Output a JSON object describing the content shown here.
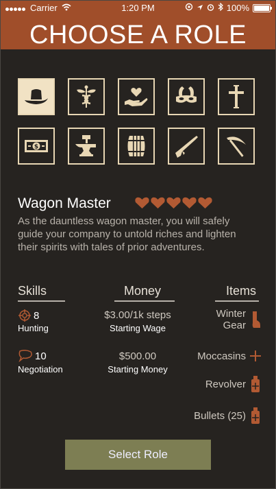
{
  "status_bar": {
    "carrier": "Carrier",
    "time": "1:20 PM",
    "battery": "100%"
  },
  "header": {
    "title": "CHOOSE A ROLE"
  },
  "roles": [
    {
      "icon": "cowboy-hat-icon",
      "selected": true
    },
    {
      "icon": "caduceus-icon",
      "selected": false
    },
    {
      "icon": "heart-in-hand-icon",
      "selected": false
    },
    {
      "icon": "horseshoe-mask-icon",
      "selected": false
    },
    {
      "icon": "cross-icon",
      "selected": false
    },
    {
      "icon": "money-bill-icon",
      "selected": false
    },
    {
      "icon": "anvil-hammer-icon",
      "selected": false
    },
    {
      "icon": "barrel-icon",
      "selected": false
    },
    {
      "icon": "rifle-icon",
      "selected": false
    },
    {
      "icon": "pickaxe-icon",
      "selected": false
    }
  ],
  "role": {
    "name": "Wagon Master",
    "hearts": 5,
    "heart_color": "#b25a33",
    "description": "As the dauntless wagon master, you will safely guide your company to untold riches and lighten their spirits with tales of prior adventures."
  },
  "columns": {
    "skills": "Skills",
    "money": "Money",
    "items": "Items"
  },
  "skills": [
    {
      "value": "8",
      "label": "Hunting",
      "icon": "crosshair-icon"
    },
    {
      "value": "10",
      "label": "Negotiation",
      "icon": "speech-bubble-icon"
    }
  ],
  "money": [
    {
      "value": "$3.00/1k steps",
      "label": "Starting Wage"
    },
    {
      "value": "$500.00",
      "label": "Starting Money"
    }
  ],
  "items": [
    {
      "label": "Winter\nGear",
      "icon": "boot-icon"
    },
    {
      "label": "Moccasins",
      "icon": "plus-icon"
    },
    {
      "label": "Revolver",
      "icon": "medicine-bottle-icon"
    },
    {
      "label": "Bullets (25)",
      "icon": "medicine-bottle-icon"
    }
  ],
  "button": {
    "label": "Select Role"
  },
  "colors": {
    "header": "#a04e2a",
    "background": "#262320",
    "accent": "#b25a33",
    "button": "#7d7e53",
    "tile_border": "#e8d7b4"
  }
}
